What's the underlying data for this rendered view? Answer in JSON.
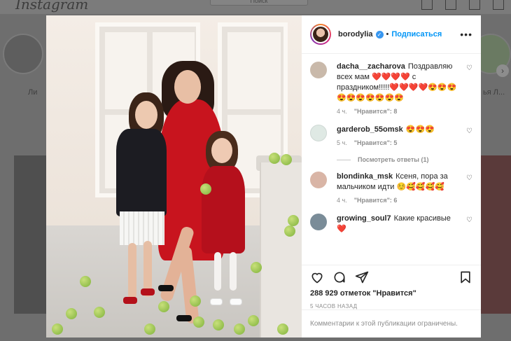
{
  "background": {
    "logo": "Instagram",
    "search_placeholder": "Поиск",
    "story_label_partial": "Ли",
    "story_label_right": "ья Л...",
    "next_arrow": "›"
  },
  "post": {
    "author": "borodylia",
    "verified": true,
    "separator": "•",
    "follow_label": "Подписаться",
    "more_label": "•••"
  },
  "comments": [
    {
      "user": "dacha__zacharova",
      "text": "Поздравляю всех мам ❤️❤️❤️❤️ с праздником!!!!!❤️❤️❤️❤️😍😍😍😍😍😍😍😍😍😍",
      "time": "4 ч.",
      "likes": "\"Нравится\": 8",
      "avatar_color": "#c9b9aa"
    },
    {
      "user": "garderob_55omsk",
      "text": "😍😍😍",
      "time": "5 ч.",
      "likes": "\"Нравится\": 5",
      "avatar_color": "#dfe9e4"
    },
    {
      "user": "blondinka_msk",
      "text": "Ксеня, пора за мальчиком идти ☺️🥰🥰🥰🥰",
      "time": "4 ч.",
      "likes": "\"Нравится\": 6",
      "avatar_color": "#d9b5a6"
    },
    {
      "user": "growing_soul7",
      "text": "Какие красивые ❤️",
      "time": "",
      "likes": "",
      "avatar_color": "#7a8c98"
    }
  ],
  "view_replies": "Посмотреть ответы (1)",
  "actions": {
    "likes_total": "288 929 отметок \"Нравится\"",
    "time_ago": "5 ЧАСОВ НАЗАД",
    "restricted_notice": "Комментарии к этой публикации ограничены."
  }
}
